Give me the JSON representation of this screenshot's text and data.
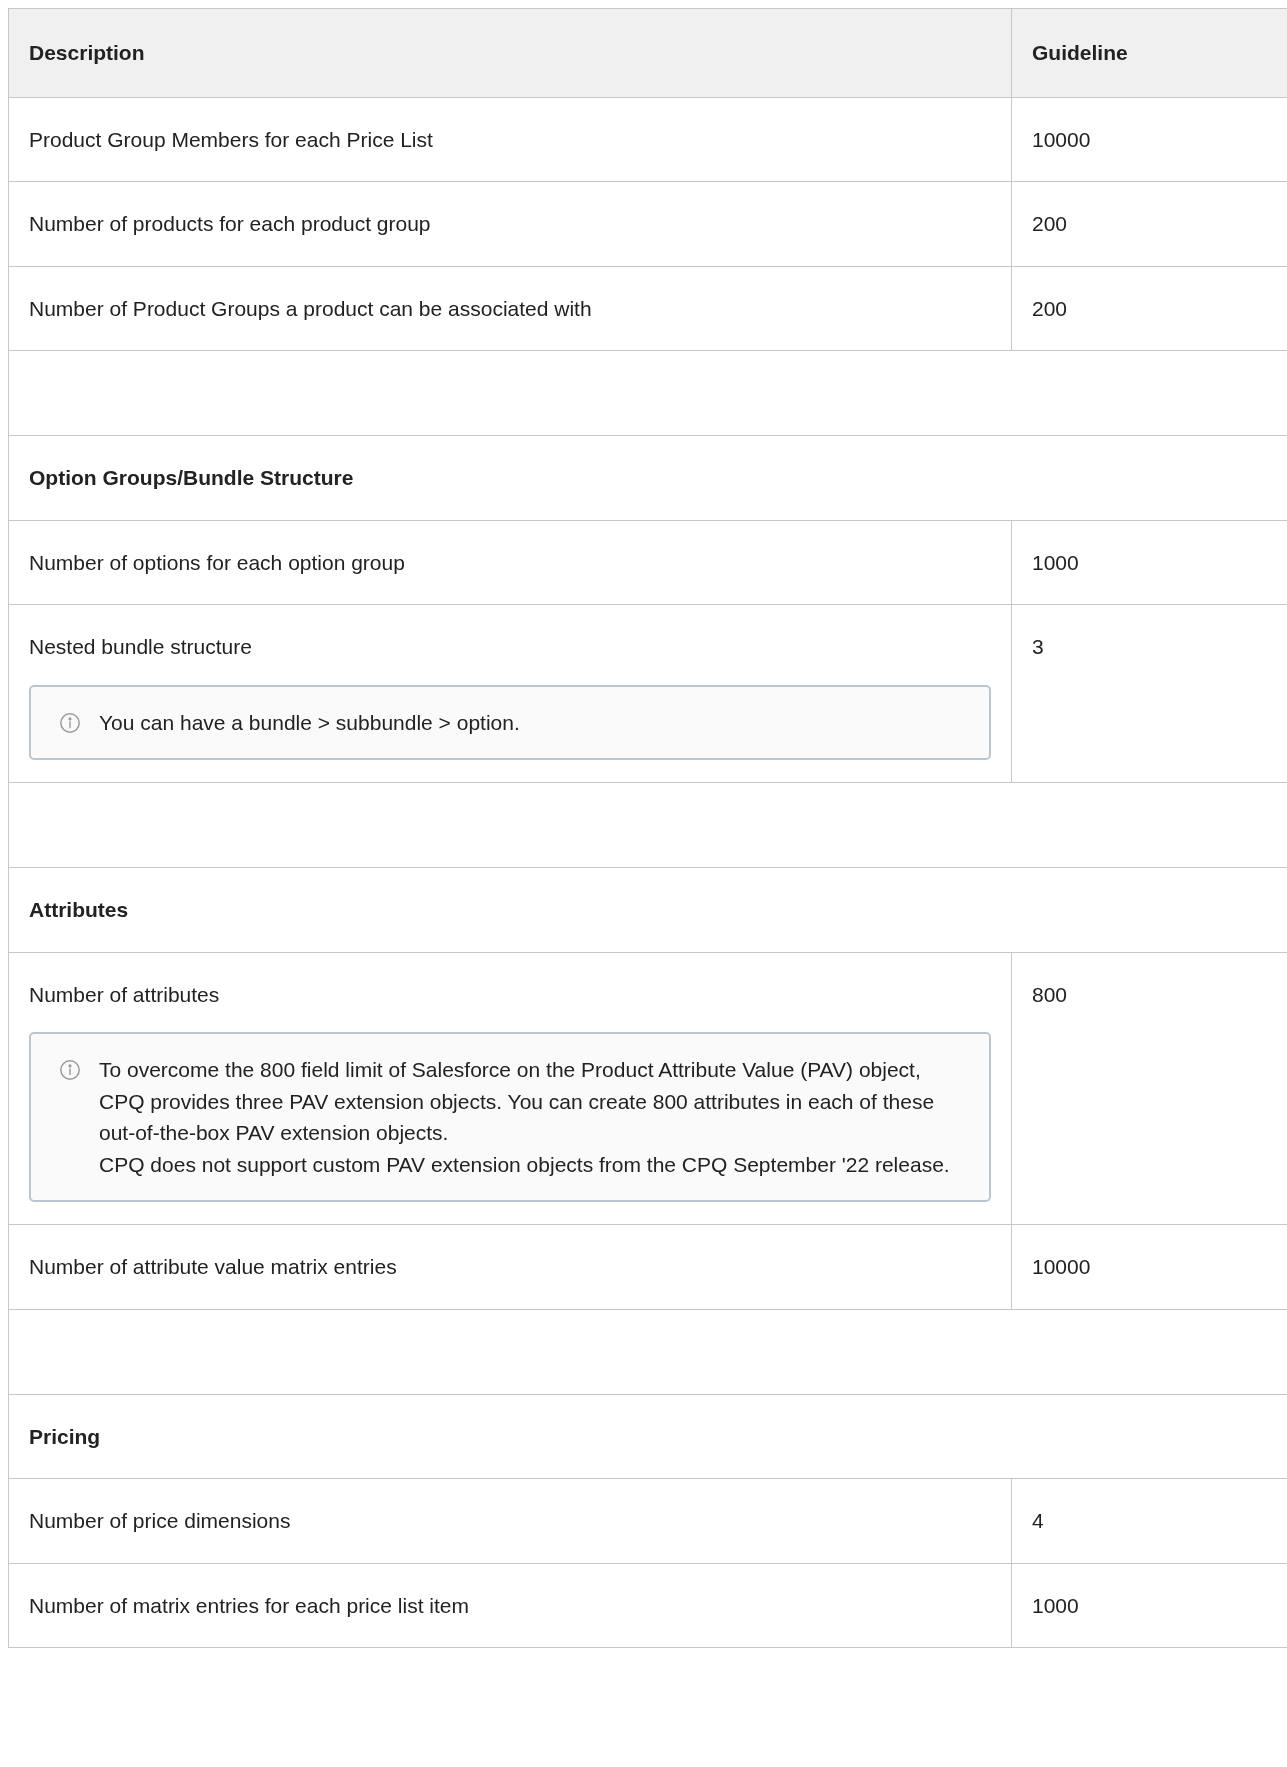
{
  "table": {
    "columns": [
      "Description",
      "Guideline"
    ],
    "rows": [
      {
        "kind": "item",
        "description": "Product Group Members for each Price List",
        "guideline": "10000"
      },
      {
        "kind": "item",
        "description": "Number of products for each product group",
        "guideline": "200"
      },
      {
        "kind": "item",
        "description": "Number of Product Groups a product can be associated with",
        "guideline": "200"
      },
      {
        "kind": "blank"
      },
      {
        "kind": "section",
        "title": "Option Groups/Bundle Structure"
      },
      {
        "kind": "item",
        "description": "Number of options for each option group",
        "guideline": "1000"
      },
      {
        "kind": "item",
        "description": "Nested bundle structure",
        "guideline": "3",
        "note": [
          "You can have a bundle > subbundle > option."
        ]
      },
      {
        "kind": "blank"
      },
      {
        "kind": "section",
        "title": "Attributes"
      },
      {
        "kind": "item",
        "description": "Number of attributes",
        "guideline": "800",
        "note": [
          "To overcome the 800 field limit of Salesforce on the Product Attribute Value (PAV) object, CPQ provides three PAV extension objects. You can create 800 attributes in each of these out-of-the-box PAV extension objects.",
          "CPQ does not support custom PAV extension objects from the CPQ September '22 release."
        ]
      },
      {
        "kind": "item",
        "description": "Number of attribute value matrix entries",
        "guideline": "10000"
      },
      {
        "kind": "blank"
      },
      {
        "kind": "section",
        "title": "Pricing"
      },
      {
        "kind": "item",
        "description": "Number of price dimensions",
        "guideline": "4"
      },
      {
        "kind": "item",
        "description": "Number of matrix entries for each price list item",
        "guideline": "1000"
      }
    ]
  }
}
